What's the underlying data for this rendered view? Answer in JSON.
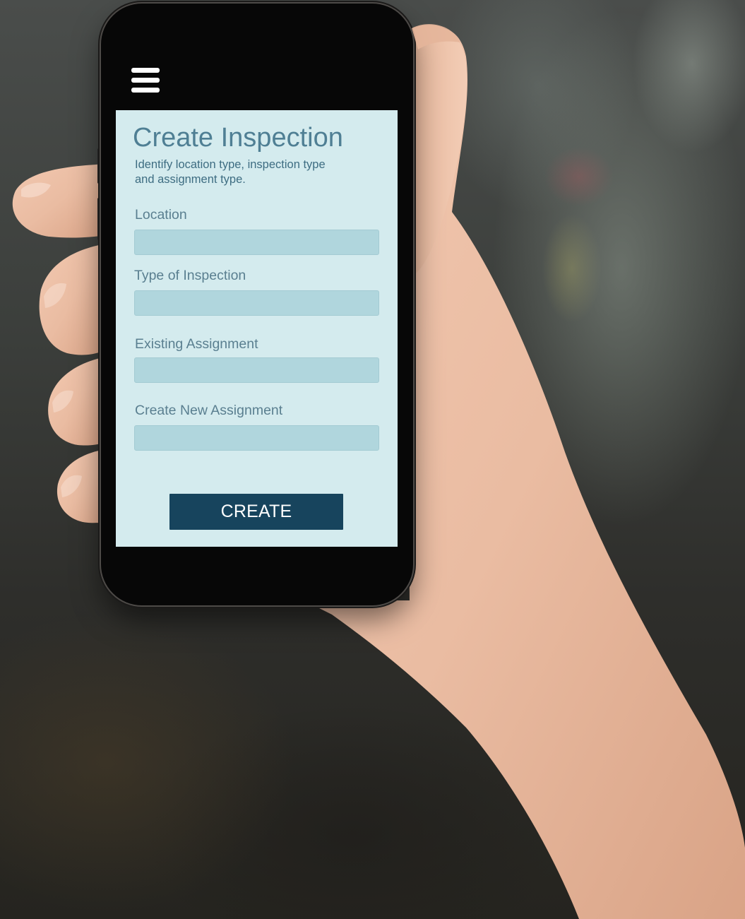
{
  "app": {
    "menu_icon": "hamburger-menu-icon"
  },
  "form": {
    "title": "Create Inspection",
    "subtitle": "Identify location type, inspection type and assignment type.",
    "fields": [
      {
        "label": "Location",
        "value": "",
        "placeholder": ""
      },
      {
        "label": "Type of Inspection",
        "value": "",
        "placeholder": ""
      },
      {
        "label": "Existing Assignment",
        "value": "",
        "placeholder": ""
      },
      {
        "label": "Create New Assignment",
        "value": "",
        "placeholder": ""
      }
    ],
    "submit_label": "CREATE"
  },
  "colors": {
    "screen_background": "#d4ebee",
    "title_text": "#4f7f94",
    "input_fill": "#b0d6dd",
    "button_fill": "#17445d",
    "button_text": "#ffffff"
  }
}
